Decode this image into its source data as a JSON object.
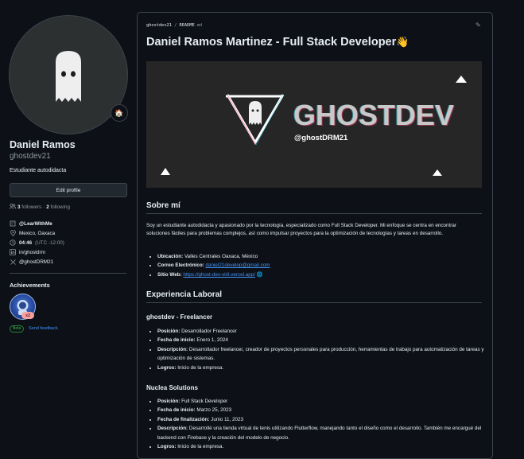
{
  "profile": {
    "name": "Daniel Ramos",
    "username": "ghostdev21",
    "bio": "Estudiante autodidacta",
    "edit_label": "Edit profile",
    "followers_count": "3",
    "followers_label": "followers",
    "following_count": "2",
    "following_label": "following",
    "separator": "·",
    "org": "@LearWithMe",
    "location": "Mexico, Oaxaca",
    "local_time": "04:46",
    "timezone": "(UTC -12:00)",
    "linkedin": "in/ghostdrm",
    "twitter": "@ghostDRM21",
    "status_emoji": "🏠"
  },
  "achievements": {
    "title": "Achievements",
    "badge_multiplier": "x2",
    "beta_label": "Beta",
    "feedback_label": "Send feedback"
  },
  "readme": {
    "breadcrumb_repo": "ghostdev21",
    "breadcrumb_sep": "/",
    "breadcrumb_file": "README",
    "breadcrumb_ext": ".md",
    "title": "Daniel Ramos Martinez - Full Stack Developer",
    "title_emoji": "👋",
    "banner_logo_text": "GHOSTDEV",
    "banner_handle": "@ghostDRM21",
    "about_heading": "Sobre mí",
    "about_text": "Soy un estudiante autodidacta y apasionado por la tecnología, especializado como Full Stack Developer. Mi enfoque se centra en encontrar soluciones fáciles para problemas complejos, así como impulsar proyectos para la optimización de tecnologías y tareas en desarrollo.",
    "contact": [
      {
        "label": "Ubicación:",
        "value": "Valles Centrales Oaxaca, México"
      },
      {
        "label": "Correo Electrónico:",
        "value": "daniel21develop@gmail.com"
      },
      {
        "label": "Sitio Web:",
        "value": "https://ghost-dev-viril.vercel.app/",
        "suffix": "🌐"
      }
    ],
    "experience_heading": "Experiencia Laboral",
    "jobs": [
      {
        "company": "ghostdev - Freelancer",
        "items": [
          {
            "label": "Posición:",
            "value": "Desarrollador Freelancer"
          },
          {
            "label": "Fecha de inicio:",
            "value": "Enero 1, 2024"
          },
          {
            "label": "Descripción:",
            "value": "Desarrollador freelancer, creador de proyectos personales para producción, herramientas de trabajo para automatización de tareas y optimización de sistemas."
          },
          {
            "label": "Logros:",
            "value": "Inicio de la empresa."
          }
        ]
      },
      {
        "company": "Nuclea Solutions",
        "items": [
          {
            "label": "Posición:",
            "value": "Full Stack Developer"
          },
          {
            "label": "Fecha de inicio:",
            "value": "Marzo 25, 2023"
          },
          {
            "label": "Fecha de finalización:",
            "value": "Junio 11, 2023"
          },
          {
            "label": "Descripción:",
            "value": "Desarrollé una tienda virtual de tenis utilizando Flutterflow, manejando tanto el diseño como el desarrollo. También me encargué del backend con Firebase y la creación del modelo de negocio."
          },
          {
            "label": "Logros:",
            "value": "Inicio de la empresa."
          }
        ]
      }
    ]
  },
  "colors": {
    "background": "#0d1117",
    "border": "#3d444d",
    "text": "#e6edf3",
    "muted": "#9198a1",
    "link": "#4493f8",
    "banner_bg": "#262626"
  }
}
